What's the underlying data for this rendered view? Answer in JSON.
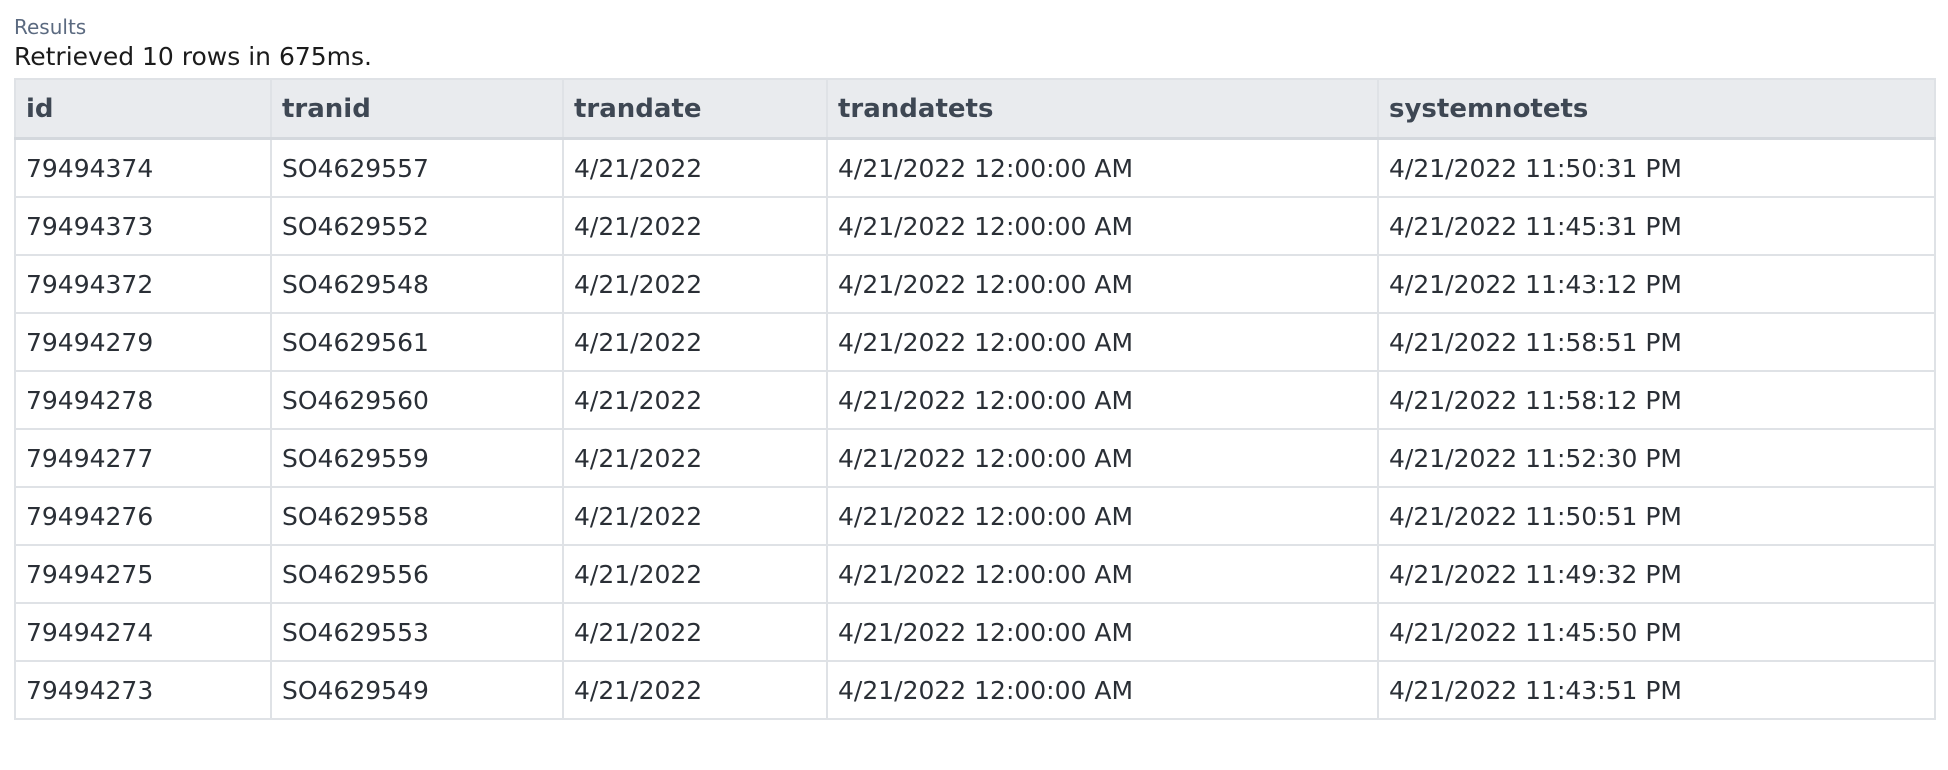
{
  "results": {
    "label": "Results",
    "summary": "Retrieved 10 rows in 675ms."
  },
  "table": {
    "columns": [
      "id",
      "tranid",
      "trandate",
      "trandatets",
      "systemnotets"
    ],
    "rows": [
      [
        "79494374",
        "SO4629557",
        "4/21/2022",
        "4/21/2022 12:00:00 AM",
        "4/21/2022 11:50:31 PM"
      ],
      [
        "79494373",
        "SO4629552",
        "4/21/2022",
        "4/21/2022 12:00:00 AM",
        "4/21/2022 11:45:31 PM"
      ],
      [
        "79494372",
        "SO4629548",
        "4/21/2022",
        "4/21/2022 12:00:00 AM",
        "4/21/2022 11:43:12 PM"
      ],
      [
        "79494279",
        "SO4629561",
        "4/21/2022",
        "4/21/2022 12:00:00 AM",
        "4/21/2022 11:58:51 PM"
      ],
      [
        "79494278",
        "SO4629560",
        "4/21/2022",
        "4/21/2022 12:00:00 AM",
        "4/21/2022 11:58:12 PM"
      ],
      [
        "79494277",
        "SO4629559",
        "4/21/2022",
        "4/21/2022 12:00:00 AM",
        "4/21/2022 11:52:30 PM"
      ],
      [
        "79494276",
        "SO4629558",
        "4/21/2022",
        "4/21/2022 12:00:00 AM",
        "4/21/2022 11:50:51 PM"
      ],
      [
        "79494275",
        "SO4629556",
        "4/21/2022",
        "4/21/2022 12:00:00 AM",
        "4/21/2022 11:49:32 PM"
      ],
      [
        "79494274",
        "SO4629553",
        "4/21/2022",
        "4/21/2022 12:00:00 AM",
        "4/21/2022 11:45:50 PM"
      ],
      [
        "79494273",
        "SO4629549",
        "4/21/2022",
        "4/21/2022 12:00:00 AM",
        "4/21/2022 11:43:51 PM"
      ]
    ]
  }
}
